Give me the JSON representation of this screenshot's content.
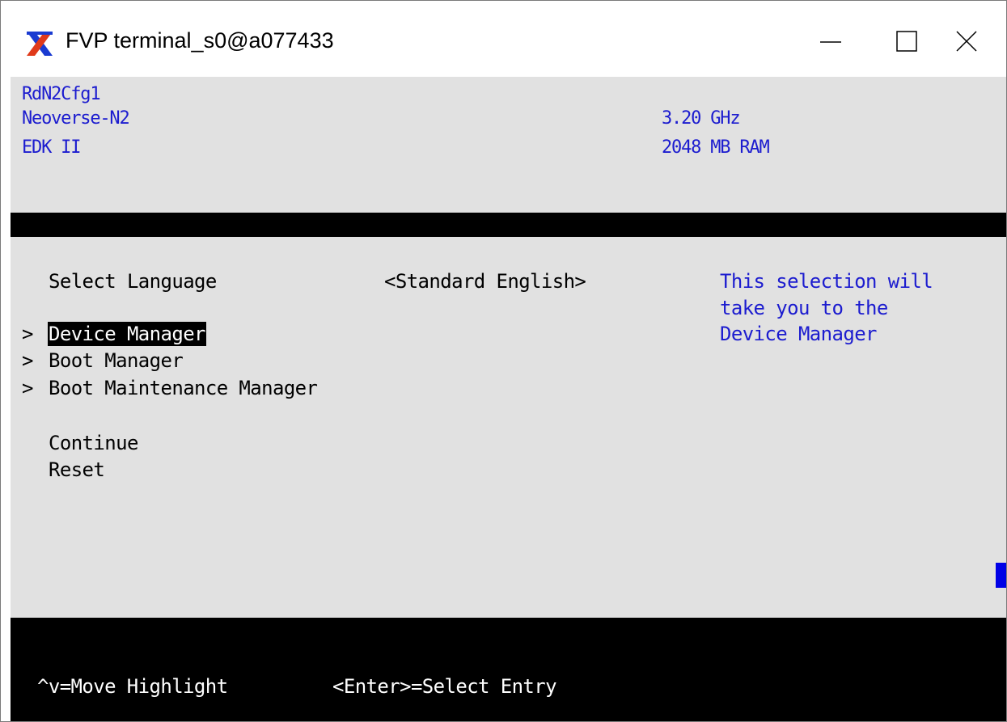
{
  "window": {
    "title": "FVP terminal_s0@a077433",
    "icon": "x-windows-icon",
    "controls": {
      "minimize_icon": "minimize-icon",
      "maximize_icon": "maximize-icon",
      "close_icon": "close-icon"
    }
  },
  "header": {
    "platform": "RdN2Cfg1",
    "cpu": "Neoverse-N2",
    "firmware": "EDK II",
    "frequency": "3.20 GHz",
    "memory": "2048 MB RAM"
  },
  "menu": {
    "language_label": "Select Language",
    "language_value": "<Standard English>",
    "items": [
      {
        "arrow": ">",
        "label": "Device Manager",
        "selected": true
      },
      {
        "arrow": ">",
        "label": "Boot Manager",
        "selected": false
      },
      {
        "arrow": ">",
        "label": "Boot Maintenance Manager",
        "selected": false
      }
    ],
    "continue_label": "Continue",
    "reset_label": "Reset"
  },
  "help": {
    "lines": [
      "This selection will",
      "take you to the",
      "Device Manager"
    ]
  },
  "footer": {
    "move_hint": "^v=Move Highlight",
    "select_hint": "<Enter>=Select Entry"
  },
  "colors": {
    "terminal_bg": "#e1e1e1",
    "header_text": "#1c1ccf",
    "help_text": "#1c1ccf",
    "scroll_indicator": "#0000e6",
    "bar": "#000000"
  }
}
